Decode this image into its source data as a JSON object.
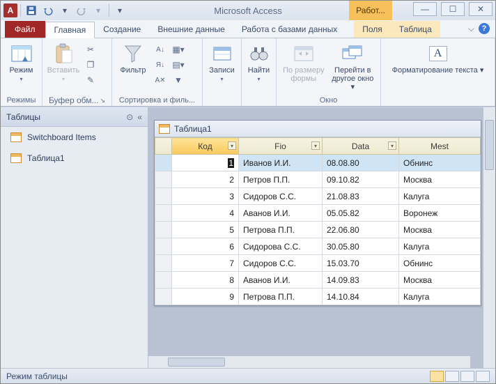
{
  "app": {
    "title": "Microsoft Access"
  },
  "context_tab_caption": "Работ...",
  "tabs": {
    "file": "Файл",
    "home": "Главная",
    "create": "Создание",
    "external": "Внешние данные",
    "dbtools": "Работа с базами данных",
    "fields": "Поля",
    "table": "Таблица"
  },
  "ribbon": {
    "views": {
      "button": "Режим",
      "group": "Режимы"
    },
    "clipboard": {
      "paste": "Вставить",
      "group": "Буфер обм..."
    },
    "sortfilter": {
      "filter": "Фильтр",
      "group": "Сортировка и филь..."
    },
    "records": {
      "button": "Записи"
    },
    "find": {
      "button": "Найти"
    },
    "window": {
      "sizeToFit": "По размеру формы",
      "switch": "Перейти в другое окно ▾",
      "group": "Окно"
    },
    "textfmt": {
      "button": "Форматирование текста ▾"
    }
  },
  "nav": {
    "header": "Таблицы",
    "items": [
      {
        "label": "Switchboard Items"
      },
      {
        "label": "Таблица1"
      }
    ]
  },
  "subwindow": {
    "title": "Таблица1"
  },
  "columns": [
    "Код",
    "Fio",
    "Data",
    "Mest"
  ],
  "rows": [
    {
      "id": "1",
      "fio": "Иванов И.И.",
      "data": "08.08.80",
      "mesto": "Обнинс"
    },
    {
      "id": "2",
      "fio": "Петров П.П.",
      "data": "09.10.82",
      "mesto": "Москва"
    },
    {
      "id": "3",
      "fio": "Сидоров С.С.",
      "data": "21.08.83",
      "mesto": "Калуга"
    },
    {
      "id": "4",
      "fio": "Аванов И.И.",
      "data": "05.05.82",
      "mesto": "Воронеж"
    },
    {
      "id": "5",
      "fio": "Петрова П.П.",
      "data": "22.06.80",
      "mesto": "Москва"
    },
    {
      "id": "6",
      "fio": "Сидорова С.С.",
      "data": "30.05.80",
      "mesto": "Калуга"
    },
    {
      "id": "7",
      "fio": "Сидоров С.С.",
      "data": "15.03.70",
      "mesto": "Обнинс"
    },
    {
      "id": "8",
      "fio": "Аванов И.И.",
      "data": "14.09.83",
      "mesto": "Москва"
    },
    {
      "id": "9",
      "fio": "Петрова П.П.",
      "data": "14.10.84",
      "mesto": "Калуга"
    }
  ],
  "status": {
    "mode": "Режим таблицы"
  }
}
